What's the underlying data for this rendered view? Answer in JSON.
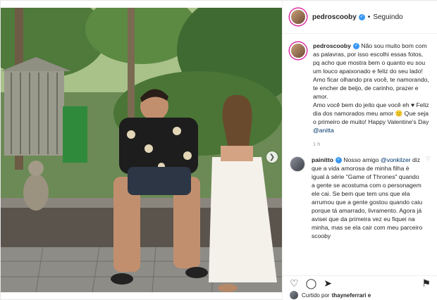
{
  "post": {
    "username": "pedroscooby",
    "follow_label": "Seguindo",
    "separator": "•",
    "caption_lines": [
      "Não sou muito bom com as palavras, por isso escolhi essas fotos, pq acho que mostra bem o quanto eu sou um louco apaixonado e feliz do seu lado!",
      "Amo ficar olhando pra você, te namorando, te encher de beijo, de carinho, prazer e amor.",
      "Amo você bem do jeito que você eh ♥ Feliz dia dos namorados meu amor 🙂 Que seja o primeiro de muito! Happy Valentine's Day"
    ],
    "caption_mention": "@anitta",
    "caption_time": "1 h"
  },
  "comment": {
    "username": "painitto",
    "prefix": "Nosso amigo",
    "mention": "@vonkilzer",
    "text": "diz que a vida amorosa de minha filha é igual à série \"Game of Thrones\" quando a gente se acostuma com o personagem ele cai. Se bem que tem uns que ela arrumou que a gente gostou quando caiu porque tá amarrado, livramento. Agora já avisei que da primeira vez eu fiquei na minha, mas se ela cair com meu parceiro scooby"
  },
  "likes": {
    "prefix": "Curtido por",
    "user": "thayneferrari e"
  },
  "icons": {
    "heart": "heart-icon",
    "comment": "comment-icon",
    "share": "share-icon",
    "save": "bookmark-icon",
    "next": "chevron-right-icon"
  },
  "colors": {
    "verified": "#3897f0",
    "mention": "#003569",
    "story_ring": "#d6249f"
  }
}
